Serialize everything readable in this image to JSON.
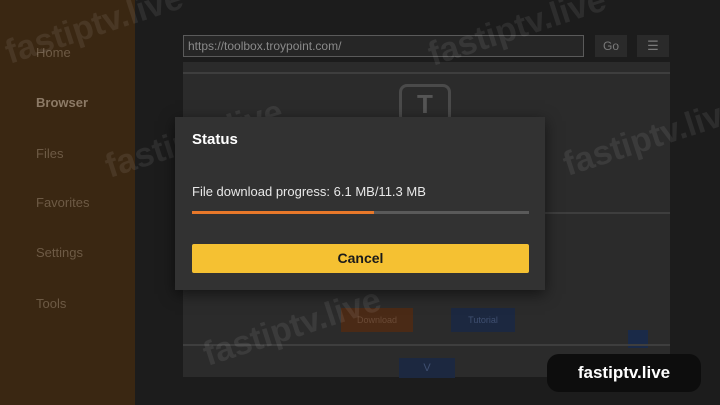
{
  "sidebar": {
    "items": [
      {
        "label": "Home"
      },
      {
        "label": "Browser"
      },
      {
        "label": "Files"
      },
      {
        "label": "Favorites"
      },
      {
        "label": "Settings"
      },
      {
        "label": "Tools"
      }
    ]
  },
  "browser": {
    "url": "https://toolbox.troypoint.com/",
    "go_label": "Go",
    "menu_icon": "hamburger-menu-icon",
    "page": {
      "logo_letter": "T",
      "orange_button_label": "Download",
      "blue_button_label": "Tutorial",
      "bottom_button_label": "V"
    }
  },
  "dialog": {
    "title": "Status",
    "progress_text": "File download progress: 6.1 MB/11.3 MB",
    "downloaded_mb": 6.1,
    "total_mb": 11.3,
    "cancel_label": "Cancel"
  },
  "watermark": "fastiptv.live",
  "badge": "fastiptv.live",
  "colors": {
    "sidebar_bg": "#3a2712",
    "dialog_bg": "#323232",
    "progress_fill": "#e8782a",
    "cancel_button": "#f5c132"
  }
}
